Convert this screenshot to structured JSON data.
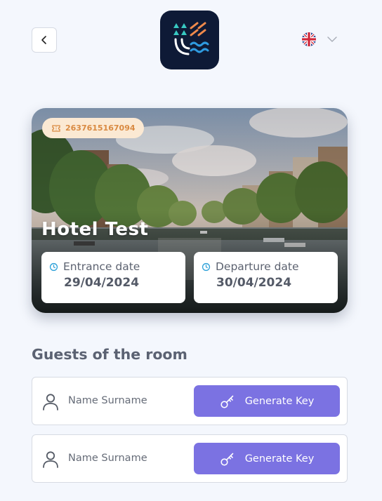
{
  "header": {
    "back_icon": "chevron-left-icon",
    "logo_icon": "app-logo",
    "language": {
      "flag_icon": "uk-flag-icon",
      "dropdown_icon": "chevron-down-icon"
    }
  },
  "hotel": {
    "booking_number": "2637615167094",
    "booking_icon": "ticket-icon",
    "name": "Hotel Test",
    "entrance": {
      "label": "Entrance date",
      "value": "29/04/2024",
      "icon": "clock-icon"
    },
    "departure": {
      "label": "Departure date",
      "value": "30/04/2024",
      "icon": "clock-icon"
    }
  },
  "guests": {
    "title": "Guests of the room",
    "items": [
      {
        "name": "Name Surname",
        "button_label": "Generate Key",
        "icon": "person-icon",
        "button_icon": "key-icon"
      },
      {
        "name": "Name Surname",
        "button_label": "Generate Key",
        "icon": "person-icon",
        "button_icon": "key-icon"
      }
    ]
  },
  "colors": {
    "background": "#f4f7fd",
    "accent": "#7b72e2",
    "badge_bg": "#fbe9d3",
    "badge_text": "#d98a42",
    "clock_icon": "#2a9fd8",
    "logo_bg": "#0e1a36"
  }
}
